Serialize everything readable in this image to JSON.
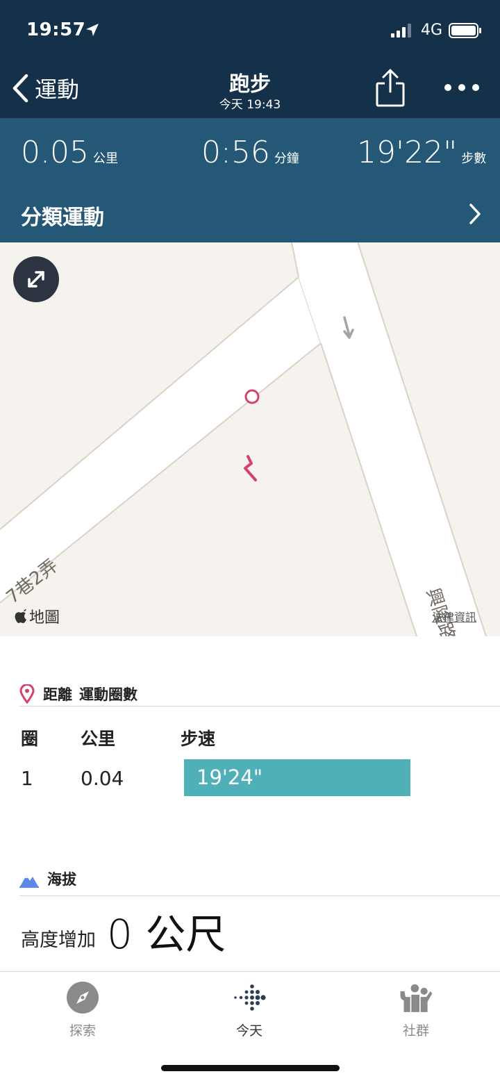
{
  "status_bar": {
    "time": "19:57",
    "network": "4G"
  },
  "nav": {
    "back_label": "運動",
    "title": "跑步",
    "subtitle": "今天 19:43"
  },
  "stats": [
    {
      "value": "0.05",
      "unit": "公里"
    },
    {
      "value": "0:56",
      "unit": "分鐘"
    },
    {
      "value": "19'22\"",
      "unit": "步數"
    }
  ],
  "category": {
    "label": "分類運動"
  },
  "map": {
    "street_1": "7巷2弄",
    "street_2": "興隆路",
    "brand": "地圖",
    "legal": "法律資訊"
  },
  "distance": {
    "title": "距離",
    "subtitle": "運動圈數",
    "headers": {
      "lap": "圈",
      "km": "公里",
      "pace": "步速"
    },
    "rows": [
      {
        "lap": "1",
        "km": "0.04",
        "pace": "19'24\""
      }
    ]
  },
  "elevation": {
    "title": "海拔",
    "label": "高度增加",
    "value": "0 公尺"
  },
  "tabs": [
    {
      "label": "探索",
      "icon": "compass-icon"
    },
    {
      "label": "今天",
      "icon": "fitbit-dots-icon"
    },
    {
      "label": "社群",
      "icon": "community-icon"
    }
  ],
  "colors": {
    "header_bg": "#153049",
    "stats_bg": "#245876",
    "pace_bar": "#4fb0b7",
    "route": "#d6416b",
    "map_bg": "#f6f3ee"
  }
}
